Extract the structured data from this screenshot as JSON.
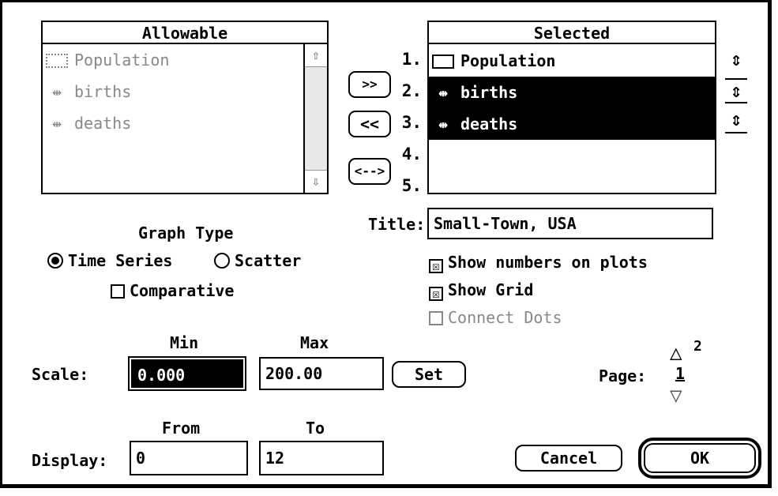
{
  "allowable": {
    "header": "Allowable",
    "items": [
      {
        "label": "Population",
        "icon": "stock-box-icon"
      },
      {
        "label": "births",
        "icon": "flow-icon"
      },
      {
        "label": "deaths",
        "icon": "flow-icon"
      }
    ],
    "scroll_up": "⇧",
    "scroll_down": "⇩"
  },
  "move_buttons": {
    "add": ">>",
    "remove": "<<",
    "swap": "<-->"
  },
  "row_numbers": [
    "1.",
    "2.",
    "3.",
    "4.",
    "5."
  ],
  "selected": {
    "header": "Selected",
    "items": [
      {
        "label": "Population",
        "icon": "stock-box-icon"
      },
      {
        "label": "births",
        "icon": "flow-icon"
      },
      {
        "label": "deaths",
        "icon": "flow-icon"
      }
    ]
  },
  "sort_icons": [
    "⇕",
    "⇕",
    "⇕"
  ],
  "flow_glyph": "⇹",
  "graph_type": {
    "heading": "Graph Type",
    "time_series": "Time Series",
    "scatter": "Scatter",
    "comparative": "Comparative",
    "selected": "time_series",
    "comparative_checked": false
  },
  "title": {
    "label": "Title:",
    "value": "Small-Town, USA"
  },
  "options": {
    "show_numbers": "Show numbers on plots",
    "show_grid": "Show Grid",
    "connect_dots": "Connect Dots",
    "checked_mark": "☒",
    "show_numbers_checked": true,
    "show_grid_checked": true,
    "connect_dots_checked": false
  },
  "scale": {
    "label": "Scale:",
    "min_label": "Min",
    "max_label": "Max",
    "min": "0.000",
    "max": "200.00",
    "set": "Set"
  },
  "page": {
    "label": "Page:",
    "current": "1",
    "total": "2",
    "up": "△",
    "down": "▽"
  },
  "display": {
    "label": "Display:",
    "from_label": "From",
    "to_label": "To",
    "from": "0",
    "to": "12"
  },
  "buttons": {
    "cancel": "Cancel",
    "ok": "OK"
  }
}
